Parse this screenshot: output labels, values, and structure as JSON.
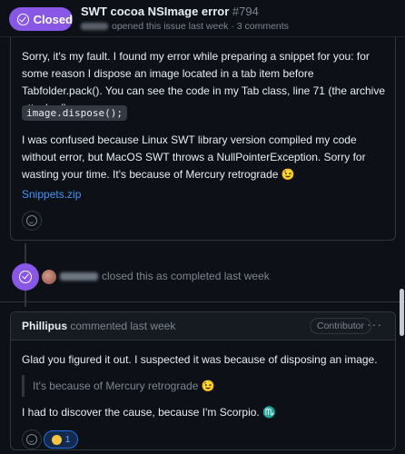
{
  "header": {
    "state": "Closed",
    "title": "SWT cocoa NSImage error",
    "number": "#794",
    "meta": "opened this issue last week · 3 comments"
  },
  "comment1": {
    "paragraph1": "Sorry, it's my fault. I found my error while preparing a snippet for you: for some reason I dispose an image located in a tab item before Tabfolder.pack(). You can see the code in my Tab class, line 71 (the archive attached):",
    "code": "image.dispose();",
    "paragraph2": "I was confused because Linux SWT library version compiled my code without error, but MacOS SWT throws a NullPointerException. Sorry for wasting your time. It's because of Mercury retrograde 😉",
    "attachment": "Snippets.zip"
  },
  "event": {
    "text": "closed this as completed last week"
  },
  "comment2": {
    "author": "Phillipus",
    "action": "commented last week",
    "badge": "Contributor",
    "more": "···",
    "line1": "Glad you figured it out. I suspected it was because of disposing an image.",
    "quote": "It's because of Mercury retrograde 😉",
    "line2": "I had to discover the cause, because I'm Scorpio. ♏",
    "reaction_count": "1"
  },
  "colors": {
    "closed": "#8957e5",
    "link": "#4493f8",
    "background": "#0d1117",
    "border": "#30363d"
  }
}
